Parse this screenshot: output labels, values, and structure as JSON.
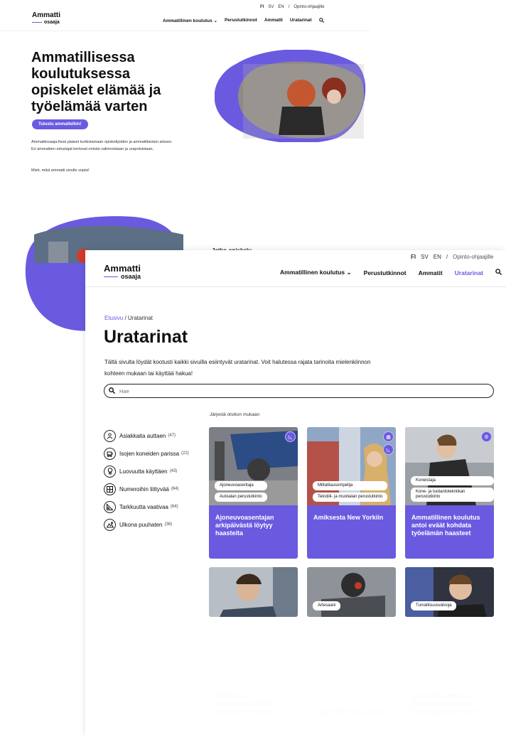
{
  "colors": {
    "accent": "#6a5ae0",
    "text": "#111111"
  },
  "background_page": {
    "utility": {
      "fi": "FI",
      "sv": "SV",
      "en": "EN",
      "sep": "/",
      "link": "Opinto-ohjaajille"
    },
    "logo": {
      "line1": "Ammatti",
      "line2": "osaaja"
    },
    "nav": [
      "Ammatillinen koulutus",
      "Perustutkinnot",
      "Ammatit",
      "Uratarinat"
    ],
    "hero_title": "Ammatillisessa koulutuksessa opiskelet elämää ja työelämää varten",
    "cta": "Tutustu ammatteihin!",
    "description": "Ammattiosaaja.fissä pääset kurkistamaan opiskelijoiden ja ammattilaisten arkeen. Eri ammattien edustajat kertovat omista valinnoistaan ja urapoluistaan.",
    "description2": "Mieti, mikä ammatti sinulle sopisi!",
    "peek_text": "Jatko-opiskelu"
  },
  "page": {
    "utility": {
      "fi": "FI",
      "sv": "SV",
      "en": "EN",
      "sep": "/",
      "link": "Opinto-ohjaajille"
    },
    "logo": {
      "line1": "Ammatti",
      "line2": "osaaja"
    },
    "nav": {
      "item1": "Ammatillinen koulutus",
      "item2": "Perustutkinnot",
      "item3": "Ammatit",
      "item4": "Uratarinat"
    },
    "breadcrumb": {
      "home": "Etusivu",
      "sep": " / ",
      "current": "Uratarinat"
    },
    "title": "Uratarinat",
    "intro": "Tältä sivulta löydät kootusti kaikki sivuilla esiintyvät uratarinat. Voit halutessa rajata tarinoita mielenkiinnon kohteen mukaan tai käyttää hakua!",
    "search": {
      "placeholder": "Hae"
    },
    "sort_label": "Järjestä otsikon mukaan",
    "filters": [
      {
        "label": "Asiakkaita auttaen",
        "count": "(47)",
        "icon": "person-icon"
      },
      {
        "label": "Isojen koneiden parissa",
        "count": "(22)",
        "icon": "machine-icon"
      },
      {
        "label": "Luovuutta käyttäen",
        "count": "(43)",
        "icon": "bulb-icon"
      },
      {
        "label": "Numeroihin liittyvää",
        "count": "(64)",
        "icon": "calculator-icon"
      },
      {
        "label": "Tarkkuutta vaativaa",
        "count": "(64)",
        "icon": "ruler-icon"
      },
      {
        "label": "Ulkona puuhaten",
        "count": "(36)",
        "icon": "outdoor-icon"
      }
    ],
    "cards": [
      {
        "tags": [
          "Ajoneuvoasentaja",
          "Autoalan perustutkinto"
        ],
        "caption": "Ajoneuvoasentajan arkipäivästä löytyy haasteita"
      },
      {
        "tags": [
          "Mittatilausompelija",
          "Tekstiili- ja muotialan perustutkinto"
        ],
        "caption": "Amiksesta New Yorkiin"
      },
      {
        "tags": [
          "Koneistaja",
          "Kone- ja tuotantotekniikan perustutkinto"
        ],
        "caption": "Ammatillinen koulutus antoi eväät kohdata työelämän haasteet"
      }
    ],
    "cards_row2": [
      {
        "tag": ""
      },
      {
        "tag": "Artesaani"
      },
      {
        "tag": "Turvallisuusvalvoja"
      }
    ]
  }
}
